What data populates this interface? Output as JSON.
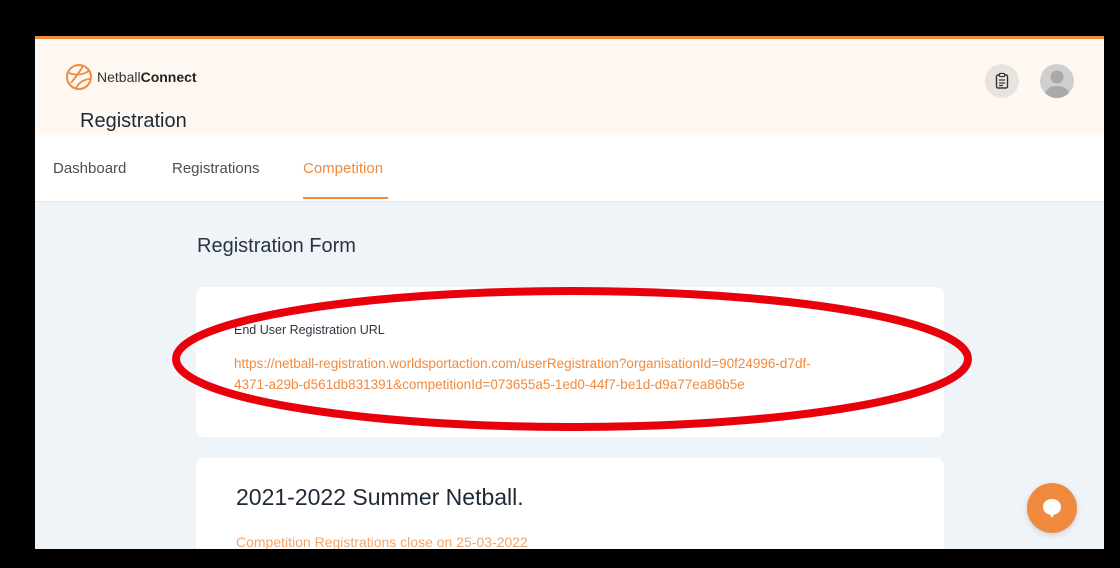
{
  "brand": {
    "name_regular": "Netball",
    "name_bold": "Connect"
  },
  "header": {
    "title": "Registration"
  },
  "nav": {
    "items": [
      {
        "label": "Dashboard"
      },
      {
        "label": "Registrations"
      },
      {
        "label": "Competition"
      }
    ],
    "active": "Competition"
  },
  "form": {
    "title": "Registration Form",
    "url_label": "End User Registration URL",
    "url_line1": "https://netball-registration.worldsportaction.com/userRegistration?organisationId=90f24996-d7df-",
    "url_line2": "4371-a29b-d561db831391&competitionId=073655a5-1ed0-44f7-be1d-d9a77ea86b5e"
  },
  "competition": {
    "name": "2021-2022 Summer Netball.",
    "close_text": "Competition Registrations close on 25-03-2022"
  },
  "colors": {
    "accent": "#f08a3e",
    "annotation": "#e8000b"
  },
  "icons": [
    "netball-logo-icon",
    "clipboard-icon",
    "user-avatar-icon",
    "chat-icon"
  ]
}
